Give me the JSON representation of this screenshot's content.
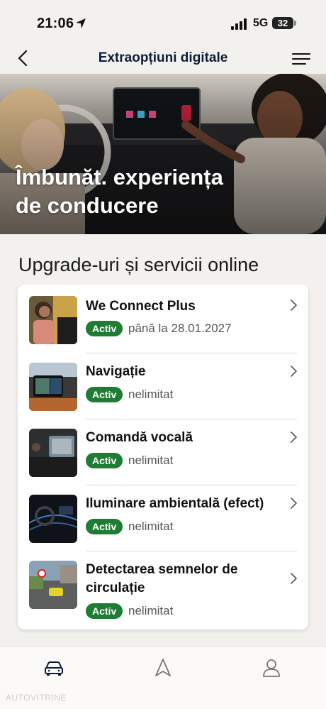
{
  "status_bar": {
    "time": "21:06",
    "network": "5G",
    "battery": "32"
  },
  "header": {
    "title": "Extraopțiuni digitale"
  },
  "hero": {
    "title": "Îmbunăt. experiența de conducere"
  },
  "section": {
    "title": "Upgrade-uri și servicii online"
  },
  "items": [
    {
      "title": "We Connect Plus",
      "badge": "Activ",
      "subtitle": "până la 28.01.2027",
      "icon": "person-with-phone-photo"
    },
    {
      "title": "Navigație",
      "badge": "Activ",
      "subtitle": "nelimitat",
      "icon": "navigation-screen-photo"
    },
    {
      "title": "Comandă vocală",
      "badge": "Activ",
      "subtitle": "nelimitat",
      "icon": "voice-command-photo"
    },
    {
      "title": "Iluminare ambientală (efect)",
      "badge": "Activ",
      "subtitle": "nelimitat",
      "icon": "ambient-light-photo"
    },
    {
      "title": "Detectarea semnelor de circulație",
      "badge": "Activ",
      "subtitle": "nelimitat",
      "icon": "traffic-sign-photo"
    }
  ],
  "tab_bar": [
    "car-icon",
    "navigation-icon",
    "profile-icon"
  ],
  "watermark": "AUTOVITRINE",
  "colors": {
    "badge": "#1e7d33",
    "title": "#0e1c3a",
    "background": "#f3f1ee"
  }
}
